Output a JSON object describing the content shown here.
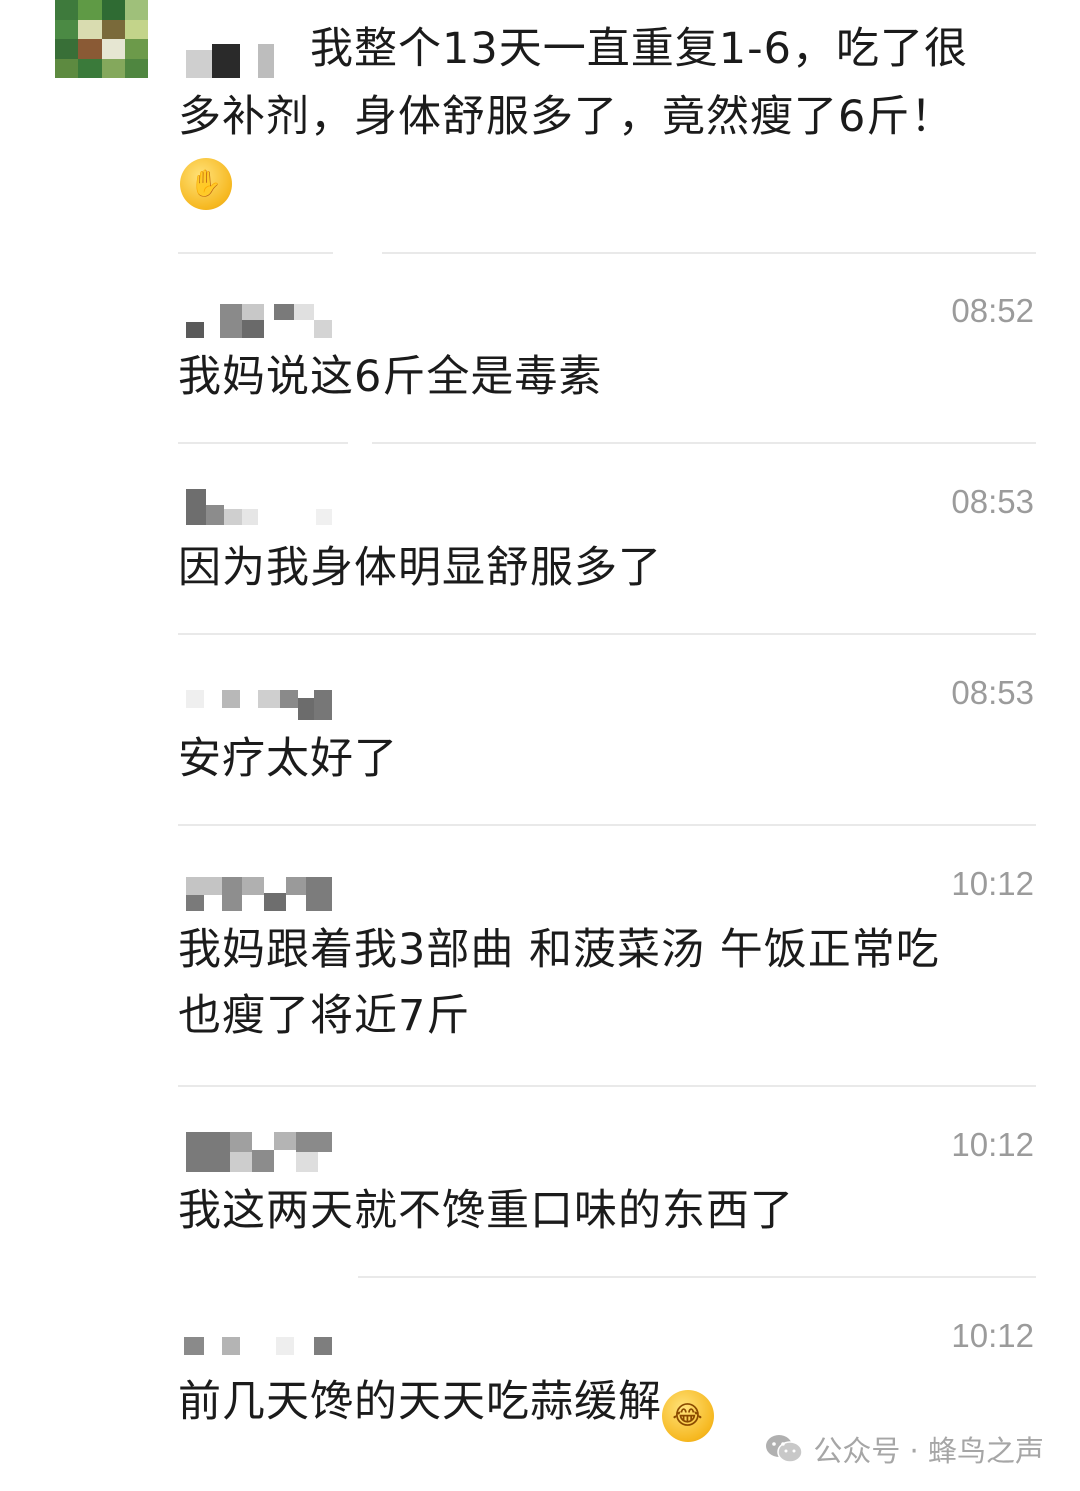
{
  "first_comment": {
    "text_line1": "我整个13天一直重复1-6，吃了很",
    "text_line2": "多补剂，身体舒服多了，竟然瘦了6斤！",
    "emoji": "face-palm-emoji"
  },
  "comments": [
    {
      "time": "08:52",
      "lines": [
        "我妈说这6斤全是毒素"
      ]
    },
    {
      "time": "08:53",
      "lines": [
        "因为我身体明显舒服多了"
      ]
    },
    {
      "time": "08:53",
      "lines": [
        "安疗太好了"
      ]
    },
    {
      "time": "10:12",
      "lines": [
        "我妈跟着我3部曲 和菠菜汤 午饭正常吃",
        "也瘦了将近7斤"
      ]
    },
    {
      "time": "10:12",
      "lines": [
        "我这两天就不馋重口味的东西了"
      ]
    },
    {
      "time": "10:12",
      "lines": [
        "前几天馋的天天吃蒜缓解"
      ],
      "emoji": "laughing-tears-emoji"
    }
  ],
  "watermark": {
    "label": "公众号 · 蜂鸟之声",
    "icon": "wechat-icon"
  }
}
